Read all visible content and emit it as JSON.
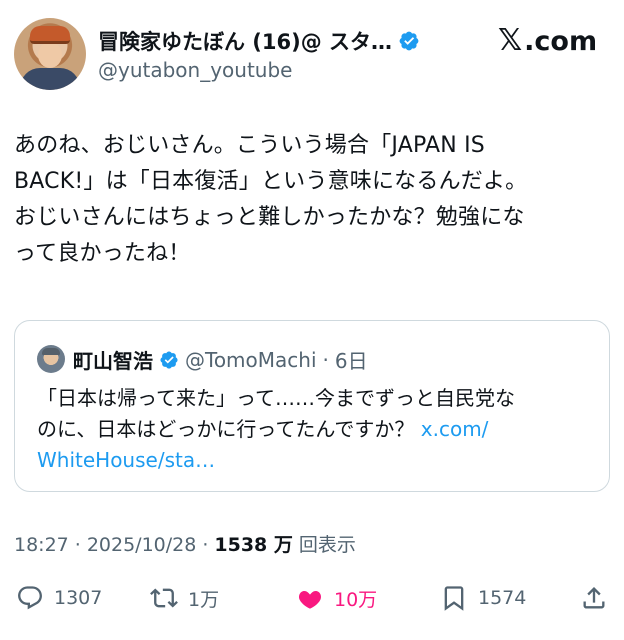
{
  "author": {
    "display_name": "冒険家ゆたぼん (16)@ スタ…",
    "handle": "@yutabon_youtube",
    "verified_icon": "verified-badge-icon"
  },
  "brand": {
    "mark": "𝕏",
    "text": ".com"
  },
  "post": {
    "lines": [
      "あのね、おじいさん。こういう場合「JAPAN IS",
      "BACK!」は「日本復活」という意味になるんだよ。",
      "おじいさんにはちょっと難しかったかな？勉強にな",
      "って良かったね！"
    ]
  },
  "quote": {
    "display_name": "町山智浩",
    "handle": "@TomoMachi",
    "dot": "·",
    "time": "6日",
    "lines": [
      "「日本は帰って来た」って……今までずっと自民党な",
      "のに、日本はどっかに行ってたんですか？"
    ],
    "link_part1": "x.com/",
    "link_part2": "WhiteHouse/sta…"
  },
  "meta": {
    "time": "18:27",
    "sep1": "·",
    "date": "2025/10/28",
    "sep2": "·",
    "views": "1538 万",
    "views_label": "回表示"
  },
  "actions": {
    "replies": "1307",
    "reposts": "1万",
    "likes": "10万",
    "bookmarks": "1574"
  },
  "colors": {
    "accent": "#1d9bf0",
    "like": "#f91880",
    "muted": "#536471",
    "text": "#0f1419"
  }
}
